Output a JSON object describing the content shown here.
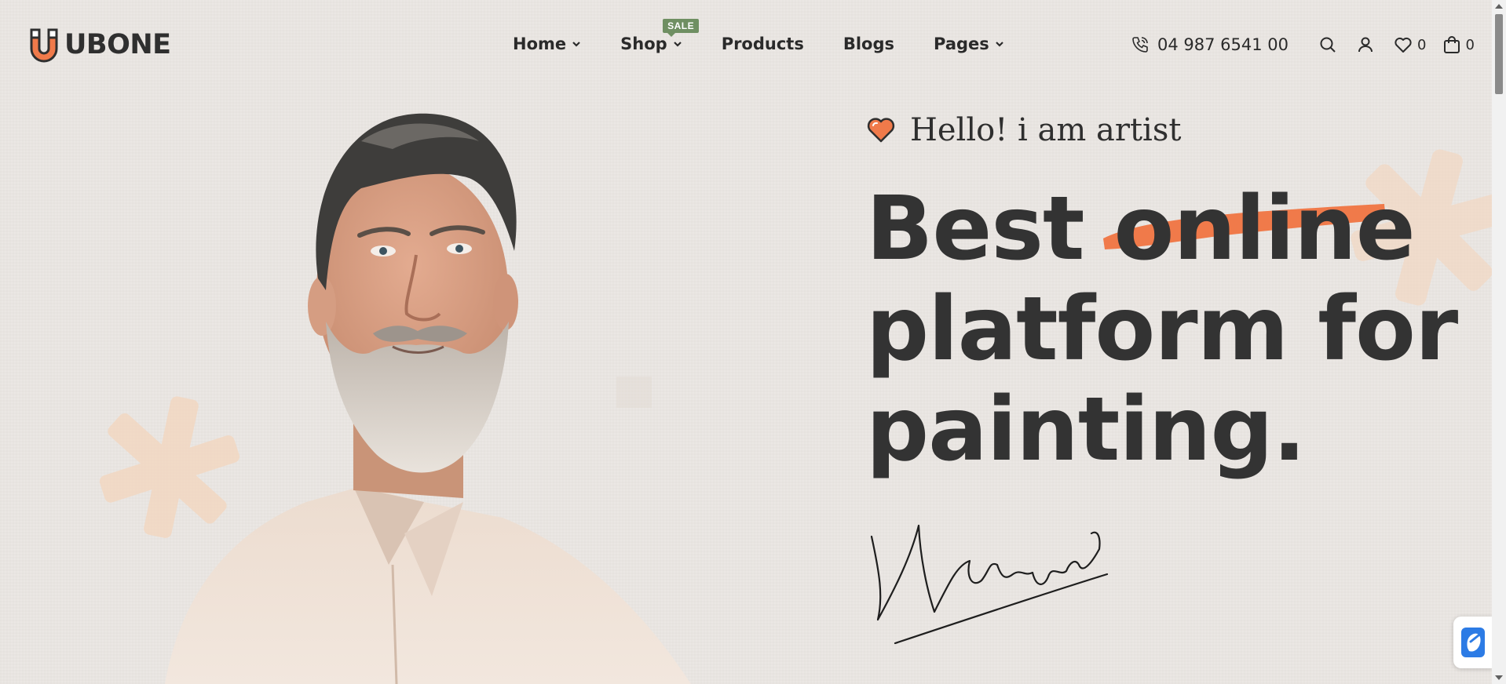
{
  "brand": {
    "name": "UBONE",
    "accent": "#f07a4a"
  },
  "nav": {
    "items": [
      {
        "label": "Home",
        "has_dropdown": true
      },
      {
        "label": "Shop",
        "has_dropdown": true,
        "badge": "SALE"
      },
      {
        "label": "Products",
        "has_dropdown": false
      },
      {
        "label": "Blogs",
        "has_dropdown": false
      },
      {
        "label": "Pages",
        "has_dropdown": true
      }
    ]
  },
  "tools": {
    "phone": "04 987 6541 00",
    "search_icon": "search-icon",
    "account_icon": "user-icon",
    "wishlist_count": "0",
    "cart_count": "0"
  },
  "hero": {
    "greeting": "Hello! i am artist",
    "headline_word1": "Best",
    "headline_highlight": "online",
    "headline_line2": "platform for",
    "headline_line3": "painting.",
    "signature": "Nelson woodie"
  },
  "colors": {
    "background": "#ebe7e3",
    "text": "#333333",
    "accent": "#f07a4a",
    "sale_badge": "#6f8f62"
  }
}
